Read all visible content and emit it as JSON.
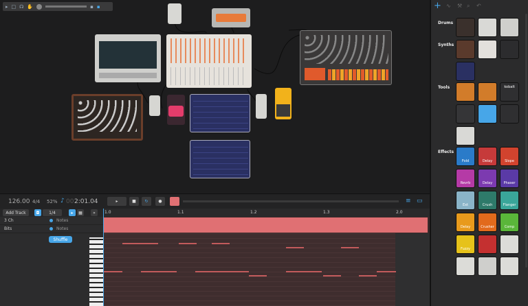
{
  "transport": {
    "tempo": "126.00",
    "signature": "4/4",
    "swing": "52%",
    "time_dim": "00",
    "time": "2:01.04"
  },
  "sequencer": {
    "add_track": "Add Track",
    "quantize": "1/4"
  },
  "tracks": [
    {
      "name": "3 Ch",
      "notes": "Notes"
    },
    {
      "name": "Bits",
      "notes": "Notes"
    }
  ],
  "shuffle": "Shuffle",
  "ruler": [
    "1.0",
    "1.1",
    "1.2",
    "1.3",
    "2.0"
  ],
  "sidebar": {
    "categories": [
      "Drums",
      "Synths",
      "Tools",
      "Effects"
    ],
    "devices": {
      "tool_label": "kobalt"
    },
    "effects": [
      "Fold",
      "Delay",
      "Slope",
      "Revrb",
      "Delay",
      "Phaser",
      "Ext",
      "Crush",
      "Flanger",
      "Delay",
      "Crusher",
      "Comp",
      "Fuzzy",
      "",
      "",
      ""
    ]
  },
  "colors": {
    "accent": "#47a6e8",
    "clip": "#e07073",
    "canvas": "#1d1d1e"
  }
}
